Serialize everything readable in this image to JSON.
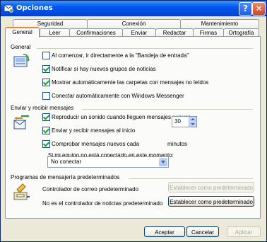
{
  "window": {
    "title": "Opciones",
    "help_glyph": "?",
    "close_glyph": "✕"
  },
  "tabs_back": [
    {
      "label": "Seguridad"
    },
    {
      "label": "Conexión"
    },
    {
      "label": "Mantenimiento"
    }
  ],
  "tabs_front": [
    {
      "label": "General"
    },
    {
      "label": "Leer"
    },
    {
      "label": "Confirmaciones"
    },
    {
      "label": "Enviar"
    },
    {
      "label": "Redactar"
    },
    {
      "label": "Firmas"
    },
    {
      "label": "Ortografía"
    }
  ],
  "active_tab": "General",
  "general": {
    "title": "General",
    "options": [
      {
        "label": "Al comenzar, ir directamente a la \"Bandeja de entrada\"",
        "checked": false
      },
      {
        "label": "Notificar si hay nuevos grupos de noticias",
        "checked": true
      },
      {
        "label": "Mostrar automáticamente las carpetas con mensajes no leídos",
        "checked": true
      },
      {
        "label": "Conectar automáticamente con Windows Messenger",
        "checked": false
      }
    ]
  },
  "send_receive": {
    "title": "Enviar y recibir mensajes",
    "options": [
      {
        "label": "Reproducir un sonido cuando lleguen mensajes nuevos",
        "checked": true
      },
      {
        "label": "Enviar y recibir mensajes al inicio",
        "checked": true
      },
      {
        "label": "Comprobar mensajes nuevos cada",
        "checked": true
      }
    ],
    "interval_value": "30",
    "interval_unit": "minutos",
    "offline_label": "Si mi equipo no está conectado en este momento:",
    "offline_selected": "No conectar"
  },
  "default_programs": {
    "title": "Programas de mensajería predeterminados",
    "mail_label": "Controlador de correo predeterminado",
    "mail_button": "Establecer como predeterminado",
    "news_label": "No es el controlador de noticias predeterminado",
    "news_button": "Establecer como predeterminado"
  },
  "buttons": {
    "accept": "Aceptar",
    "cancel": "Cancelar",
    "apply": "Aplicar"
  },
  "icons": {
    "title": "mail-options-icon",
    "general": "inbox-sync-icon",
    "send_receive": "send-receive-icon",
    "programs": "mail-handler-icon"
  }
}
